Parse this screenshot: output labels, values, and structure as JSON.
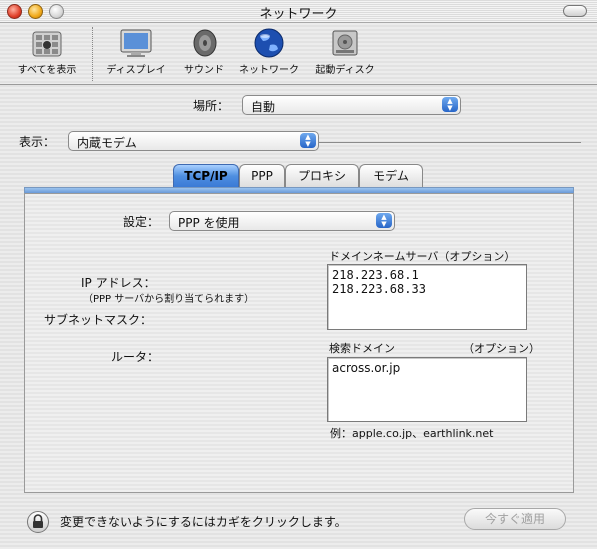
{
  "window": {
    "title": "ネットワーク"
  },
  "toolbar": {
    "items": [
      {
        "label": "すべてを表示",
        "icon": "show-all-icon"
      },
      {
        "label": "ディスプレイ",
        "icon": "display-icon"
      },
      {
        "label": "サウンド",
        "icon": "speaker-icon"
      },
      {
        "label": "ネットワーク",
        "icon": "globe-icon"
      },
      {
        "label": "起動ディスク",
        "icon": "disk-icon"
      }
    ]
  },
  "location": {
    "label": "場所：",
    "value": "自動"
  },
  "show": {
    "label": "表示：",
    "value": "内蔵モデム"
  },
  "tabs": [
    {
      "label": "TCP/IP",
      "active": true
    },
    {
      "label": "PPP",
      "active": false
    },
    {
      "label": "プロキシ",
      "active": false
    },
    {
      "label": "モデム",
      "active": false
    }
  ],
  "tcpip": {
    "config_label": "設定：",
    "config_value": "PPP を使用",
    "ip_label": "IP アドレス：",
    "ip_note": "（PPP サーバから割り当てられます）",
    "subnet_label": "サブネットマスク：",
    "router_label": "ルータ：",
    "dns_label": "ドメインネームサーバ（オプション）",
    "dns_values": [
      "218.223.68.1",
      "218.223.68.33"
    ],
    "search_label": "検索ドメイン",
    "search_optional": "（オプション）",
    "search_value": "across.or.jp",
    "example": "例：apple.co.jp、earthlink.net"
  },
  "footer": {
    "lock_text": "変更できないようにするにはカギをクリックします。",
    "apply_label": "今すぐ適用"
  }
}
